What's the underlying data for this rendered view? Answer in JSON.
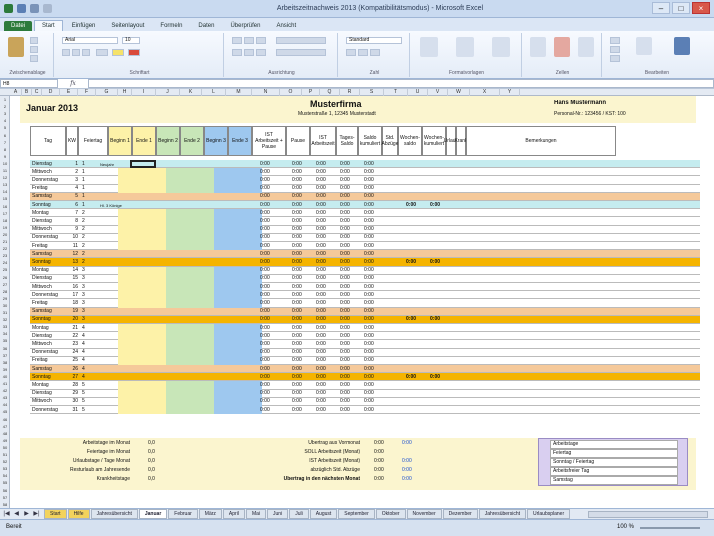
{
  "window": {
    "title": "Arbeitszeitnachweis 2013 (Kompatibilitätsmodus) - Microsoft Excel"
  },
  "ribbon": {
    "tabs": [
      "Datei",
      "Start",
      "Einfügen",
      "Seitenlayout",
      "Formeln",
      "Daten",
      "Überprüfen",
      "Ansicht"
    ],
    "active_tab": "Start",
    "groups": [
      "Zwischenablage",
      "Schriftart",
      "Ausrichtung",
      "Zahl",
      "Formatvorlagen",
      "Zellen",
      "Bearbeiten"
    ],
    "font_name": "Arial",
    "font_size": "10",
    "number_format": "Standard",
    "sort_filter": "Sortieren und Filtern",
    "find_select": "Suchen und Auswählen"
  },
  "formula_bar": {
    "name_box": "H8",
    "fx": "fx",
    "value": ""
  },
  "columns": [
    "A",
    "B",
    "C",
    "D",
    "E",
    "F",
    "G",
    "H",
    "I",
    "J",
    "K",
    "L",
    "M",
    "N",
    "O",
    "P",
    "Q",
    "R",
    "S",
    "T",
    "U",
    "V",
    "W",
    "X",
    "Y"
  ],
  "header": {
    "month": "Januar 2013",
    "company": "Musterfirma",
    "address": "Musterstraße 1, 12345 Musterstadt",
    "employee": "Hans Mustermann",
    "personnel": "Personal-Nr.: 123456 / KST: 100"
  },
  "col_captions": [
    "Tag",
    "KW",
    "Feiertag",
    "Beginn 1",
    "Ende 1",
    "Beginn 2",
    "Ende 2",
    "Beginn 3",
    "Ende 3",
    "IST Arbeitszeit + Pause",
    "Pause",
    "IST Arbeitszeit",
    "Tages-Saldo",
    "Saldo kumuliert",
    "Std. Abzüge",
    "Wochen-saldo",
    "Wochen-kumuliert",
    "Urlaub",
    "Krank",
    "Bemerkungen"
  ],
  "rows": [
    {
      "day": "Dienstag",
      "n": "1",
      "kw": "1",
      "hol": "Neujahr",
      "type": "holiday"
    },
    {
      "day": "Mittwoch",
      "n": "2",
      "kw": "1",
      "hol": "",
      "type": "normal"
    },
    {
      "day": "Donnerstag",
      "n": "3",
      "kw": "1",
      "hol": "",
      "type": "normal"
    },
    {
      "day": "Freitag",
      "n": "4",
      "kw": "1",
      "hol": "",
      "type": "normal"
    },
    {
      "day": "Samstag",
      "n": "5",
      "kw": "1",
      "hol": "",
      "type": "sat"
    },
    {
      "day": "Sonntag",
      "n": "6",
      "kw": "1",
      "hol": "Hl. 3 Könige",
      "type": "sunhol"
    },
    {
      "day": "Montag",
      "n": "7",
      "kw": "2",
      "hol": "",
      "type": "normal"
    },
    {
      "day": "Dienstag",
      "n": "8",
      "kw": "2",
      "hol": "",
      "type": "normal"
    },
    {
      "day": "Mittwoch",
      "n": "9",
      "kw": "2",
      "hol": "",
      "type": "normal"
    },
    {
      "day": "Donnerstag",
      "n": "10",
      "kw": "2",
      "hol": "",
      "type": "normal"
    },
    {
      "day": "Freitag",
      "n": "11",
      "kw": "2",
      "hol": "",
      "type": "normal"
    },
    {
      "day": "Samstag",
      "n": "12",
      "kw": "2",
      "hol": "",
      "type": "sat"
    },
    {
      "day": "Sonntag",
      "n": "13",
      "kw": "2",
      "hol": "",
      "type": "sun"
    },
    {
      "day": "Montag",
      "n": "14",
      "kw": "3",
      "hol": "",
      "type": "normal"
    },
    {
      "day": "Dienstag",
      "n": "15",
      "kw": "3",
      "hol": "",
      "type": "normal"
    },
    {
      "day": "Mittwoch",
      "n": "16",
      "kw": "3",
      "hol": "",
      "type": "normal"
    },
    {
      "day": "Donnerstag",
      "n": "17",
      "kw": "3",
      "hol": "",
      "type": "normal"
    },
    {
      "day": "Freitag",
      "n": "18",
      "kw": "3",
      "hol": "",
      "type": "normal"
    },
    {
      "day": "Samstag",
      "n": "19",
      "kw": "3",
      "hol": "",
      "type": "sat"
    },
    {
      "day": "Sonntag",
      "n": "20",
      "kw": "3",
      "hol": "",
      "type": "sun"
    },
    {
      "day": "Montag",
      "n": "21",
      "kw": "4",
      "hol": "",
      "type": "normal"
    },
    {
      "day": "Dienstag",
      "n": "22",
      "kw": "4",
      "hol": "",
      "type": "normal"
    },
    {
      "day": "Mittwoch",
      "n": "23",
      "kw": "4",
      "hol": "",
      "type": "normal"
    },
    {
      "day": "Donnerstag",
      "n": "24",
      "kw": "4",
      "hol": "",
      "type": "normal"
    },
    {
      "day": "Freitag",
      "n": "25",
      "kw": "4",
      "hol": "",
      "type": "normal"
    },
    {
      "day": "Samstag",
      "n": "26",
      "kw": "4",
      "hol": "",
      "type": "sat"
    },
    {
      "day": "Sonntag",
      "n": "27",
      "kw": "4",
      "hol": "",
      "type": "sun"
    },
    {
      "day": "Montag",
      "n": "28",
      "kw": "5",
      "hol": "",
      "type": "normal"
    },
    {
      "day": "Dienstag",
      "n": "29",
      "kw": "5",
      "hol": "",
      "type": "normal"
    },
    {
      "day": "Mittwoch",
      "n": "30",
      "kw": "5",
      "hol": "",
      "type": "normal"
    },
    {
      "day": "Donnerstag",
      "n": "31",
      "kw": "5",
      "hol": "",
      "type": "normal"
    }
  ],
  "zero": "0:00",
  "summary_left": [
    {
      "label": "Arbeitstage im Monat",
      "value": "0,0"
    },
    {
      "label": "Feiertage im Monat",
      "value": "0,0"
    },
    {
      "label": "Urlaubstage / Tage Monat",
      "value": "0,0"
    },
    {
      "label": "Resturlaub am Jahresende",
      "value": "0,0"
    },
    {
      "label": "Krankheitstage",
      "value": "0,0"
    }
  ],
  "summary_mid": [
    {
      "label": "Übertrag aus Vormonat",
      "a": "0:00",
      "b": "0:00"
    },
    {
      "label": "SOLL Arbeitszeit (Monat)",
      "a": "0:00",
      "b": ""
    },
    {
      "label": "IST Arbeitszeit (Monat)",
      "a": "0:00",
      "b": "0:00"
    },
    {
      "label": "abzüglich Std. Abzüge",
      "a": "0:00",
      "b": "0:00"
    },
    {
      "label": "Übertrag in den nächsten Monat",
      "a": "0:00",
      "b": "0:00"
    }
  ],
  "legend": [
    "Arbeitstage",
    "Feiertag",
    "Sonntag / Feiertag",
    "Arbeitsfreier Tag",
    "Samstag"
  ],
  "sheet_tabs": [
    "Start",
    "Hilfe",
    "Jahresübersicht",
    "Januar",
    "Februar",
    "März",
    "April",
    "Mai",
    "Juni",
    "Juli",
    "August",
    "September",
    "Oktober",
    "November",
    "Dezember",
    "Jahresübersicht",
    "Urlaubsplaner"
  ],
  "active_sheet": "Januar",
  "status": {
    "ready": "Bereit",
    "zoom": "100 %"
  },
  "colors": {
    "accent": "#2c7a3b",
    "saturday": "#f5c99a",
    "sunday": "#f5b400",
    "holiday": "#c5ecef",
    "begin_yellow": "#fdf2a8",
    "begin_green": "#c8e6b8",
    "begin_blue": "#9ec8ef",
    "legend": "#d9cff0"
  }
}
